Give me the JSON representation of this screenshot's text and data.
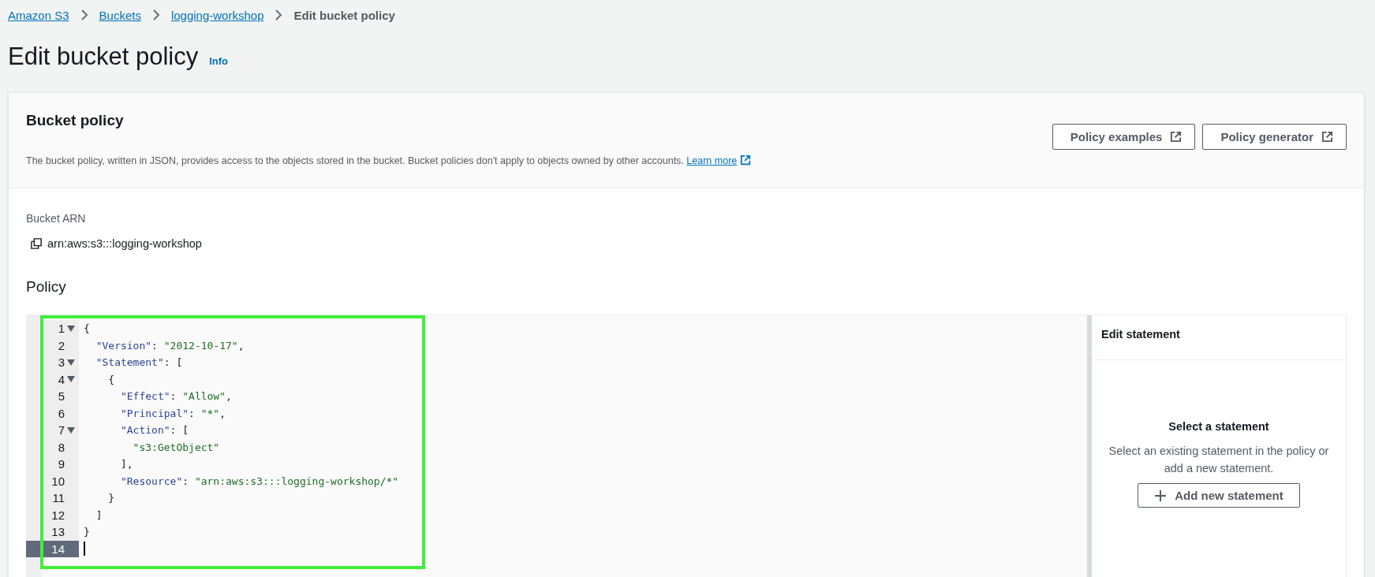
{
  "breadcrumbs": [
    {
      "text": "Amazon S3",
      "link": true
    },
    {
      "text": "Buckets",
      "link": true
    },
    {
      "text": "logging-workshop",
      "link": true
    },
    {
      "text": "Edit bucket policy",
      "link": false
    }
  ],
  "page_title": "Edit bucket policy",
  "info_link": "Info",
  "card": {
    "title": "Bucket policy",
    "description": "The bucket policy, written in JSON, provides access to the objects stored in the bucket. Bucket policies don't apply to objects owned by other accounts.",
    "learn_more": "Learn more",
    "buttons": [
      "Policy examples",
      "Policy generator"
    ]
  },
  "bucket_arn": {
    "label": "Bucket ARN",
    "value": "arn:aws:s3:::logging-workshop"
  },
  "policy_label": "Policy",
  "editor": {
    "highlighted": true,
    "lines": [
      {
        "number": "1",
        "foldable": true,
        "active": false,
        "tokens": [
          {
            "kind": "punct",
            "text": "{"
          }
        ]
      },
      {
        "number": "2",
        "foldable": false,
        "active": false,
        "tokens": [
          {
            "kind": "key",
            "text": "  \"Version\""
          },
          {
            "kind": "punct",
            "text": ": "
          },
          {
            "kind": "string",
            "text": "\"2012-10-17\""
          },
          {
            "kind": "punct",
            "text": ","
          }
        ]
      },
      {
        "number": "3",
        "foldable": true,
        "active": false,
        "tokens": [
          {
            "kind": "key",
            "text": "  \"Statement\""
          },
          {
            "kind": "punct",
            "text": ": ["
          }
        ]
      },
      {
        "number": "4",
        "foldable": true,
        "active": false,
        "tokens": [
          {
            "kind": "punct",
            "text": "    {"
          }
        ]
      },
      {
        "number": "5",
        "foldable": false,
        "active": false,
        "tokens": [
          {
            "kind": "key",
            "text": "      \"Effect\""
          },
          {
            "kind": "punct",
            "text": ": "
          },
          {
            "kind": "string",
            "text": "\"Allow\""
          },
          {
            "kind": "punct",
            "text": ","
          }
        ]
      },
      {
        "number": "6",
        "foldable": false,
        "active": false,
        "tokens": [
          {
            "kind": "key",
            "text": "      \"Principal\""
          },
          {
            "kind": "punct",
            "text": ": "
          },
          {
            "kind": "string",
            "text": "\"*\""
          },
          {
            "kind": "punct",
            "text": ","
          }
        ]
      },
      {
        "number": "7",
        "foldable": true,
        "active": false,
        "tokens": [
          {
            "kind": "key",
            "text": "      \"Action\""
          },
          {
            "kind": "punct",
            "text": ": ["
          }
        ]
      },
      {
        "number": "8",
        "foldable": false,
        "active": false,
        "tokens": [
          {
            "kind": "string",
            "text": "        \"s3:GetObject\""
          }
        ]
      },
      {
        "number": "9",
        "foldable": false,
        "active": false,
        "tokens": [
          {
            "kind": "punct",
            "text": "      ],"
          }
        ]
      },
      {
        "number": "10",
        "foldable": false,
        "active": false,
        "tokens": [
          {
            "kind": "key",
            "text": "      \"Resource\""
          },
          {
            "kind": "punct",
            "text": ": "
          },
          {
            "kind": "string",
            "text": "\"arn:aws:s3:::logging-workshop/*\""
          }
        ]
      },
      {
        "number": "11",
        "foldable": false,
        "active": false,
        "tokens": [
          {
            "kind": "punct",
            "text": "    }"
          }
        ]
      },
      {
        "number": "12",
        "foldable": false,
        "active": false,
        "tokens": [
          {
            "kind": "punct",
            "text": "  ]"
          }
        ]
      },
      {
        "number": "13",
        "foldable": false,
        "active": false,
        "tokens": [
          {
            "kind": "punct",
            "text": "}"
          }
        ]
      },
      {
        "number": "14",
        "foldable": false,
        "active": true
      }
    ]
  },
  "statement_panel": {
    "title": "Edit statement",
    "empty_title": "Select a statement",
    "empty_text": "Select an existing statement in the policy or add a new statement.",
    "add_button": "Add new statement"
  }
}
